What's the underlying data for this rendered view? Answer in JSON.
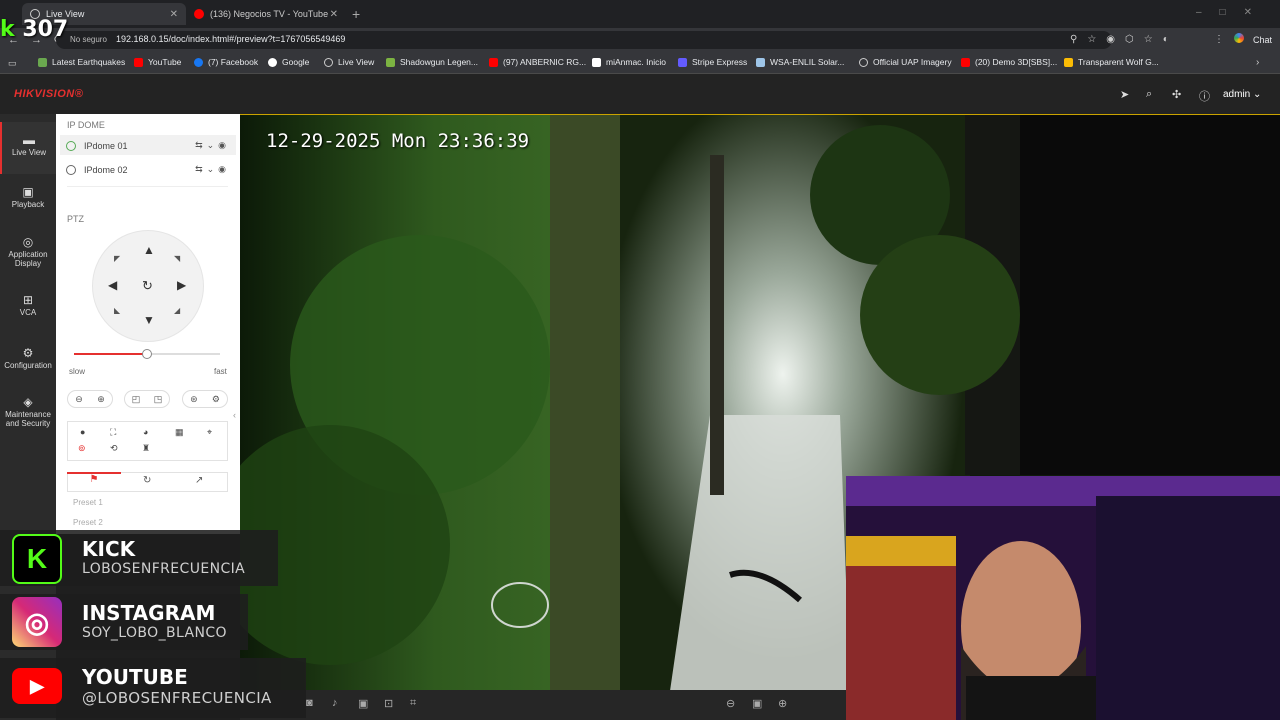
{
  "browser": {
    "tabs": [
      {
        "label": "Live View",
        "active": true
      },
      {
        "label": "(136) Negocios TV - YouTube",
        "active": false
      }
    ],
    "insecure_label": "No seguro",
    "url": "192.168.0.15/doc/index.html#/preview?t=1767056549469",
    "chat_label": "Chat",
    "bookmarks": [
      "Latest Earthquakes",
      "YouTube",
      "(7) Facebook",
      "Google",
      "Live View",
      "Shadowgun Legen...",
      "(97) ANBERNIC RG...",
      "miAnmac. Inicio",
      "Stripe Express",
      "WSA-ENLIL Solar...",
      "Official UAP Imagery",
      "(20) Demo 3D[SBS]...",
      "Transparent Wolf G..."
    ]
  },
  "app": {
    "brand": "HIKVISION®",
    "user": "admin",
    "nav": [
      {
        "label": "Live View",
        "icon": "live-view-icon"
      },
      {
        "label": "Playback",
        "icon": "playback-icon"
      },
      {
        "label": "Application Display",
        "icon": "application-icon"
      },
      {
        "label": "VCA",
        "icon": "vca-icon"
      },
      {
        "label": "Configuration",
        "icon": "gear-icon"
      },
      {
        "label": "Maintenance and Security",
        "icon": "shield-icon"
      }
    ],
    "device_group": "IP DOME",
    "cameras": [
      "IPdome 01",
      "IPdome 02"
    ],
    "ptz_title": "PTZ",
    "speed_min": "slow",
    "speed_max": "fast",
    "speed_level": 0.5,
    "presets": [
      "Preset 1",
      "Preset 2"
    ]
  },
  "video": {
    "osd_time": "12-29-2025 Mon 23:36:39"
  },
  "overlay": {
    "counter": "307",
    "socials": [
      {
        "platform": "KICK",
        "handle": "LOBOSENFRECUENCIA",
        "color": "#53fc18"
      },
      {
        "platform": "INSTAGRAM",
        "handle": "SOY_LOBO_BLANCO",
        "color": "#dd2a7b"
      },
      {
        "platform": "YOUTUBE",
        "handle": "@LOBOSENFRECUENCIA",
        "color": "#ff0000"
      }
    ]
  },
  "colors": {
    "brand_red": "#e5302f",
    "video_border": "#caa300"
  }
}
